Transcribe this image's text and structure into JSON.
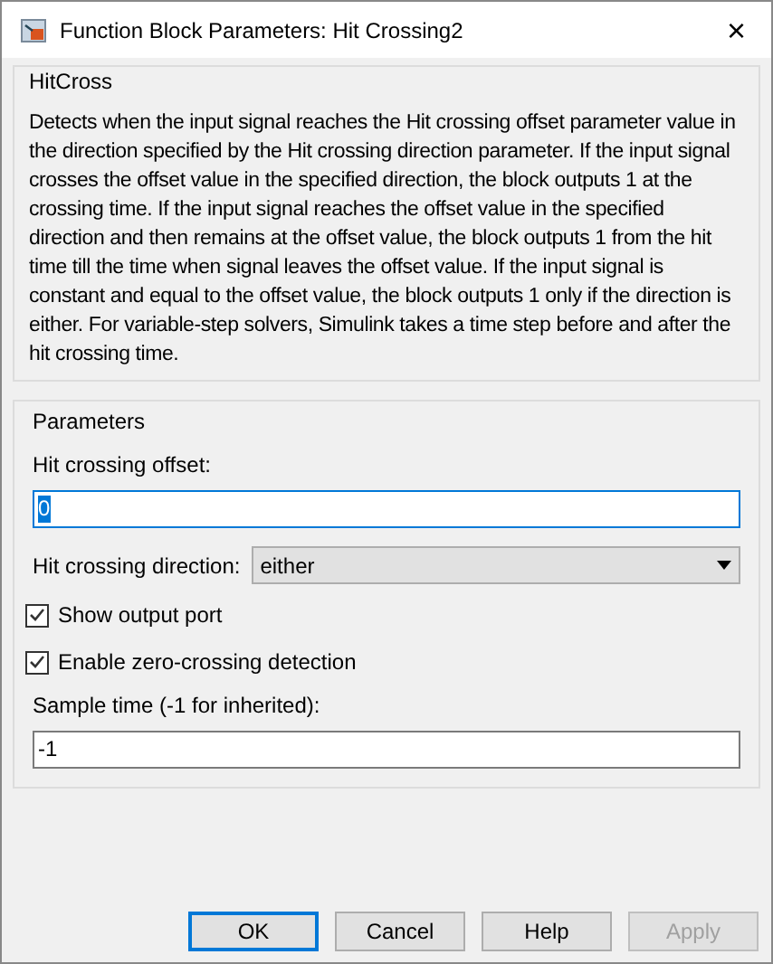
{
  "window": {
    "title": "Function Block Parameters: Hit Crossing2",
    "close": "×"
  },
  "description_group": {
    "title": "HitCross",
    "text": "Detects when the input signal reaches the Hit crossing offset parameter value in the direction specified by the Hit crossing direction parameter. If the input signal crosses the offset value in the specified direction, the block outputs 1 at the crossing time. If the input signal reaches the offset value in the specified direction and then remains at the offset value, the block outputs 1 from the hit time till the time when signal leaves the offset value. If the input signal is constant and equal to the offset value, the block outputs 1 only if the direction is either. For variable-step solvers, Simulink takes a time step before and after the hit crossing time."
  },
  "parameters": {
    "title": "Parameters",
    "items": [
      {
        "kind": "field",
        "label": "Hit crossing offset:",
        "value": "0",
        "focused": true
      },
      {
        "kind": "dropdown",
        "label": "Hit crossing direction:",
        "value": "either"
      },
      {
        "kind": "checkbox",
        "label": "Show output port",
        "checked": true
      },
      {
        "kind": "checkbox",
        "label": "Enable zero-crossing detection",
        "checked": true
      },
      {
        "kind": "field",
        "label": "Sample time (-1 for inherited):",
        "value": "-1",
        "focused": false
      }
    ]
  },
  "buttons": [
    {
      "label": "OK",
      "default": true,
      "disabled": false
    },
    {
      "label": "Cancel",
      "default": false,
      "disabled": false
    },
    {
      "label": "Help",
      "default": false,
      "disabled": false
    },
    {
      "label": "Apply",
      "default": false,
      "disabled": true
    }
  ]
}
